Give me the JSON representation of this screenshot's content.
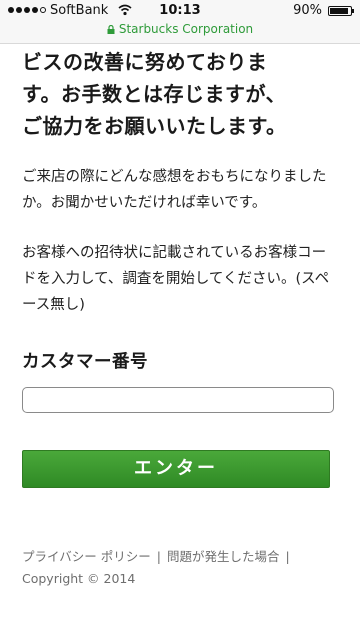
{
  "status_bar": {
    "carrier": "SoftBank",
    "time": "10:13",
    "battery_percent": "90%",
    "battery_level": 0.9,
    "signal_bars_filled": 4,
    "signal_bars_total": 5,
    "icons": [
      "signal-icon",
      "wifi-icon",
      "battery-icon"
    ]
  },
  "url_bar": {
    "secure_icon": "lock-icon",
    "title": "Starbucks Corporation",
    "color": "#2f9b3a"
  },
  "main": {
    "intro_lines": [
      "ビスの改善に努めておりま",
      "す。お手数とは存じますが、",
      "ご協力をお願いいたします。"
    ],
    "paragraph1": "ご来店の際にどんな感想をおもちになりましたか。お聞かせいただければ幸いです。",
    "paragraph2": "お客様への招待状に記載されているお客様コードを入力して、調査を開始してください。(スペース無し)",
    "field_label": "カスタマー番号",
    "field_value": "",
    "field_placeholder": "",
    "enter_label": "エンター",
    "button_color": "#3a9a2e"
  },
  "footer": {
    "privacy_link": "プライバシー ポリシー",
    "separator": "|",
    "problem_link": "問題が発生した場合",
    "trailing_separator": "|",
    "copyright": "Copyright © 2014"
  }
}
